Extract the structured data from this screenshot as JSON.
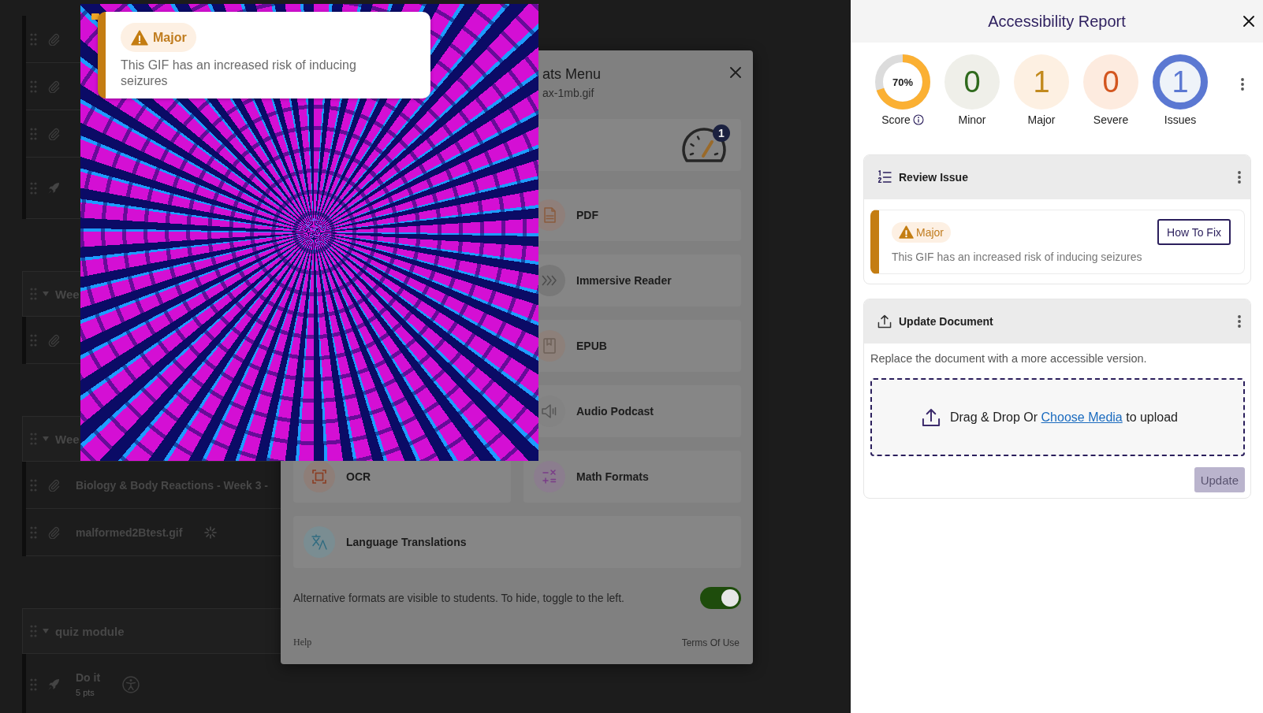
{
  "course_modules": [
    {
      "items": [
        {
          "kind": "attachment"
        },
        {
          "kind": "attachment"
        },
        {
          "kind": "attachment"
        },
        {
          "kind": "quiz"
        }
      ]
    },
    {
      "title": "Wee",
      "expanded": true,
      "items": [
        {
          "kind": "attachment"
        }
      ]
    },
    {
      "title": "Wee",
      "expanded": true,
      "items": [
        {
          "kind": "attachment",
          "title": "Biology & Body Reactions - Week 3 -"
        },
        {
          "kind": "attachment",
          "title": "malformed2Btest.gif",
          "processing": true
        }
      ]
    },
    {
      "title": "quiz module",
      "expanded": true,
      "items": [
        {
          "kind": "quiz",
          "title": "Do it",
          "points": "5 pts",
          "accessibility_flag": true
        }
      ]
    }
  ],
  "gif_preview": {
    "issue": {
      "kind": "major",
      "badge": "Major",
      "description": "This GIF has an increased risk of inducing seizures"
    }
  },
  "formats_menu": {
    "title": "ats Menu",
    "file_name": "ax-1mb.gif",
    "issue_count": "1",
    "option_rows": [
      {
        "right": {
          "kind": "pdf",
          "label": "PDF"
        }
      },
      {
        "right": {
          "kind": "immersive_reader",
          "label": "Immersive Reader"
        }
      },
      {
        "right": {
          "kind": "epub",
          "label": "EPUB"
        }
      },
      {
        "right": {
          "kind": "audio_podcast",
          "label": "Audio Podcast"
        }
      },
      {
        "left": {
          "kind": "ocr",
          "label": "OCR"
        },
        "right": {
          "kind": "math_formats",
          "label": "Math Formats"
        }
      },
      {
        "wide": {
          "kind": "language_translations",
          "label": "Language Translations"
        }
      }
    ],
    "visibility_note": "Alternative formats are visible to students. To hide, toggle to the left.",
    "visible_to_students": true,
    "help_link": "Help",
    "terms_link": "Terms Of Use"
  },
  "accessibility_report": {
    "title": "Accessibility Report",
    "score": {
      "value": "70%",
      "level": 0.7,
      "label": "Score"
    },
    "counts": [
      {
        "kind": "minor",
        "count": "0",
        "label": "Minor"
      },
      {
        "kind": "major",
        "count": "1",
        "label": "Major"
      },
      {
        "kind": "severe",
        "count": "0",
        "label": "Severe"
      },
      {
        "kind": "total",
        "count": "1",
        "label": "Issues"
      }
    ],
    "review_issue": {
      "title": "Review Issue",
      "issue": {
        "kind": "major",
        "badge": "Major",
        "fix_button": "How To Fix",
        "description": "This GIF has an increased risk of inducing seizures"
      }
    },
    "update_document": {
      "title": "Update Document",
      "description": "Replace the document with a more accessible version.",
      "drop_zone": {
        "text_before": "Drag & Drop Or",
        "link": "Choose Media",
        "text_after": "to upload"
      },
      "button": {
        "label": "Update",
        "disabled": true
      }
    }
  }
}
